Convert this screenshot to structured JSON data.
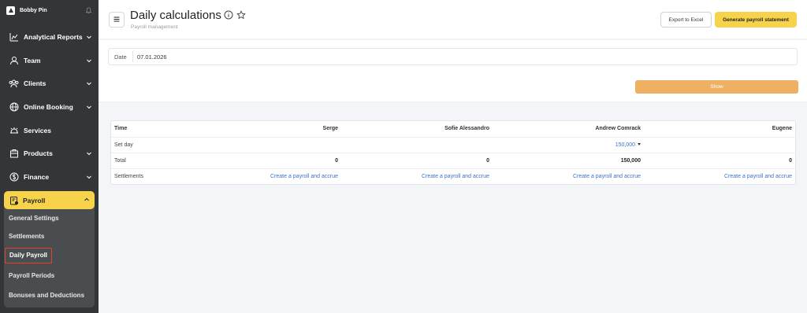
{
  "sidebar": {
    "user_name": "Bobby Pin",
    "items": [
      {
        "label": "Analytical Reports"
      },
      {
        "label": "Team"
      },
      {
        "label": "Clients"
      },
      {
        "label": "Online Booking"
      },
      {
        "label": "Services"
      },
      {
        "label": "Products"
      },
      {
        "label": "Finance"
      }
    ],
    "payroll": {
      "label": "Payroll",
      "sub_items": [
        {
          "label": "General Settings"
        },
        {
          "label": "Settlements"
        },
        {
          "label": "Daily Payroll"
        },
        {
          "label": "Payroll Periods"
        },
        {
          "label": "Bonuses and Deductions"
        }
      ]
    },
    "accent_color": "#f7d34b"
  },
  "header": {
    "title": "Daily calculations",
    "subtitle": "Payroll management",
    "export_label": "Export to Excel",
    "generate_label": "Generate payroll statement"
  },
  "filters": {
    "date_label": "Date",
    "date_value": "07.01.2026",
    "show_label": "Show"
  },
  "table": {
    "columns": [
      "Time",
      "Serge",
      "Sofie Alessandro",
      "Andrew Comrack",
      "Eugene"
    ],
    "set_day": {
      "label": "Set day",
      "values": [
        "",
        "",
        "150,000",
        ""
      ]
    },
    "total": {
      "label": "Total",
      "values": [
        "0",
        "0",
        "150,000",
        "0"
      ]
    },
    "settlements": {
      "label": "Settlements",
      "link_label": "Create a payroll and accrue"
    }
  },
  "icons": {
    "logo": "logo-icon",
    "bell": "bell-icon",
    "menu": "hamburger-icon",
    "info": "info-icon",
    "star": "star-icon"
  }
}
